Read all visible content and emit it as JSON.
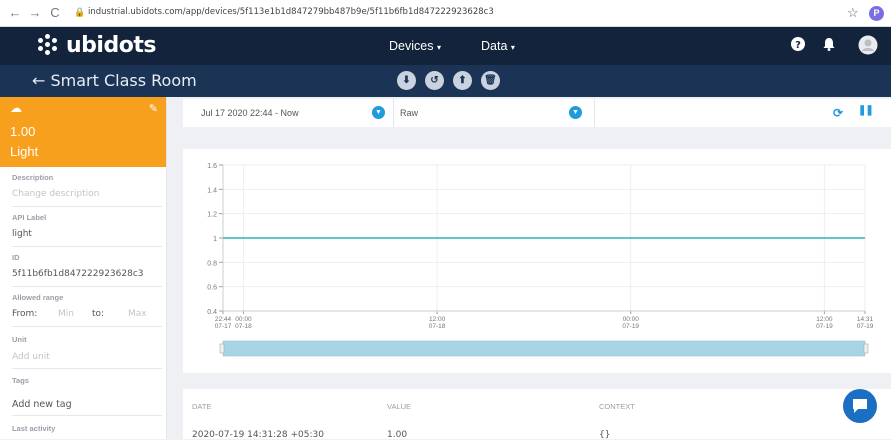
{
  "browser": {
    "url": "industrial.ubidots.com/app/devices/5f113e1b1d847279bb487b9e/5f11b6fb1d847222923628c3",
    "profile_initial": "P"
  },
  "header": {
    "brand": "ubidots",
    "menu_devices": "Devices",
    "menu_data": "Data"
  },
  "subheader": {
    "title": "← Smart Class Room"
  },
  "variable": {
    "value": "1.00",
    "name": "Light",
    "card_color": "#f7a01d"
  },
  "details": {
    "description_label": "Description",
    "description_placeholder": "Change description",
    "api_label_label": "API Label",
    "api_label_value": "light",
    "id_label": "ID",
    "id_value": "5f11b6fb1d847222923628c3",
    "range_label": "Allowed range",
    "range_from": "From:",
    "range_min": "Min",
    "range_to": "to:",
    "range_max": "Max",
    "unit_label": "Unit",
    "unit_placeholder": "Add unit",
    "tags_label": "Tags",
    "tags_add": "Add new tag",
    "last_activity_label": "Last activity"
  },
  "toolbar": {
    "date_range": "Jul 17 2020 22:44 - Now",
    "aggregation": "Raw"
  },
  "chart_data": {
    "type": "line",
    "x": [
      "2020-07-17 22:44",
      "2020-07-19 14:31"
    ],
    "series": [
      {
        "values": [
          1,
          1
        ],
        "color": "#2bb5b5"
      }
    ],
    "ylim": [
      0.4,
      1.6
    ],
    "yticks": [
      "1.6",
      "1.4",
      "1.2",
      "1",
      "0.8",
      "0.6",
      "0.4"
    ],
    "xticks": [
      {
        "time": "22:44",
        "date": "07-17"
      },
      {
        "time": "00:00",
        "date": "07-18"
      },
      {
        "time": "12:00",
        "date": "07-18"
      },
      {
        "time": "00:00",
        "date": "07-19"
      },
      {
        "time": "12:00",
        "date": "07-19"
      },
      {
        "time": "14:31",
        "date": "07-19"
      }
    ],
    "grid": true
  },
  "table": {
    "columns": [
      "DATE",
      "VALUE",
      "CONTEXT"
    ],
    "rows": [
      {
        "date": "2020-07-19 14:31:28 +05:30",
        "value": "1.00",
        "context": "{}"
      }
    ]
  }
}
